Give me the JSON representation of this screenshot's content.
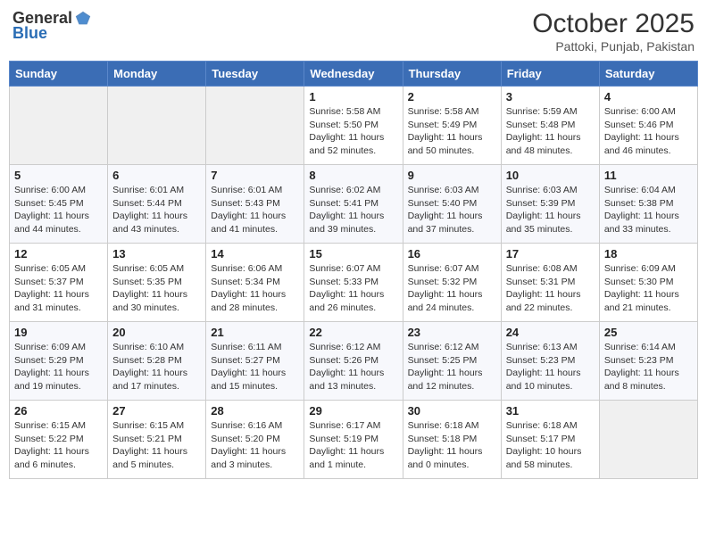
{
  "header": {
    "logo_general": "General",
    "logo_blue": "Blue",
    "month": "October 2025",
    "location": "Pattoki, Punjab, Pakistan"
  },
  "weekdays": [
    "Sunday",
    "Monday",
    "Tuesday",
    "Wednesday",
    "Thursday",
    "Friday",
    "Saturday"
  ],
  "weeks": [
    [
      {
        "day": "",
        "info": ""
      },
      {
        "day": "",
        "info": ""
      },
      {
        "day": "",
        "info": ""
      },
      {
        "day": "1",
        "info": "Sunrise: 5:58 AM\nSunset: 5:50 PM\nDaylight: 11 hours and 52 minutes."
      },
      {
        "day": "2",
        "info": "Sunrise: 5:58 AM\nSunset: 5:49 PM\nDaylight: 11 hours and 50 minutes."
      },
      {
        "day": "3",
        "info": "Sunrise: 5:59 AM\nSunset: 5:48 PM\nDaylight: 11 hours and 48 minutes."
      },
      {
        "day": "4",
        "info": "Sunrise: 6:00 AM\nSunset: 5:46 PM\nDaylight: 11 hours and 46 minutes."
      }
    ],
    [
      {
        "day": "5",
        "info": "Sunrise: 6:00 AM\nSunset: 5:45 PM\nDaylight: 11 hours and 44 minutes."
      },
      {
        "day": "6",
        "info": "Sunrise: 6:01 AM\nSunset: 5:44 PM\nDaylight: 11 hours and 43 minutes."
      },
      {
        "day": "7",
        "info": "Sunrise: 6:01 AM\nSunset: 5:43 PM\nDaylight: 11 hours and 41 minutes."
      },
      {
        "day": "8",
        "info": "Sunrise: 6:02 AM\nSunset: 5:41 PM\nDaylight: 11 hours and 39 minutes."
      },
      {
        "day": "9",
        "info": "Sunrise: 6:03 AM\nSunset: 5:40 PM\nDaylight: 11 hours and 37 minutes."
      },
      {
        "day": "10",
        "info": "Sunrise: 6:03 AM\nSunset: 5:39 PM\nDaylight: 11 hours and 35 minutes."
      },
      {
        "day": "11",
        "info": "Sunrise: 6:04 AM\nSunset: 5:38 PM\nDaylight: 11 hours and 33 minutes."
      }
    ],
    [
      {
        "day": "12",
        "info": "Sunrise: 6:05 AM\nSunset: 5:37 PM\nDaylight: 11 hours and 31 minutes."
      },
      {
        "day": "13",
        "info": "Sunrise: 6:05 AM\nSunset: 5:35 PM\nDaylight: 11 hours and 30 minutes."
      },
      {
        "day": "14",
        "info": "Sunrise: 6:06 AM\nSunset: 5:34 PM\nDaylight: 11 hours and 28 minutes."
      },
      {
        "day": "15",
        "info": "Sunrise: 6:07 AM\nSunset: 5:33 PM\nDaylight: 11 hours and 26 minutes."
      },
      {
        "day": "16",
        "info": "Sunrise: 6:07 AM\nSunset: 5:32 PM\nDaylight: 11 hours and 24 minutes."
      },
      {
        "day": "17",
        "info": "Sunrise: 6:08 AM\nSunset: 5:31 PM\nDaylight: 11 hours and 22 minutes."
      },
      {
        "day": "18",
        "info": "Sunrise: 6:09 AM\nSunset: 5:30 PM\nDaylight: 11 hours and 21 minutes."
      }
    ],
    [
      {
        "day": "19",
        "info": "Sunrise: 6:09 AM\nSunset: 5:29 PM\nDaylight: 11 hours and 19 minutes."
      },
      {
        "day": "20",
        "info": "Sunrise: 6:10 AM\nSunset: 5:28 PM\nDaylight: 11 hours and 17 minutes."
      },
      {
        "day": "21",
        "info": "Sunrise: 6:11 AM\nSunset: 5:27 PM\nDaylight: 11 hours and 15 minutes."
      },
      {
        "day": "22",
        "info": "Sunrise: 6:12 AM\nSunset: 5:26 PM\nDaylight: 11 hours and 13 minutes."
      },
      {
        "day": "23",
        "info": "Sunrise: 6:12 AM\nSunset: 5:25 PM\nDaylight: 11 hours and 12 minutes."
      },
      {
        "day": "24",
        "info": "Sunrise: 6:13 AM\nSunset: 5:23 PM\nDaylight: 11 hours and 10 minutes."
      },
      {
        "day": "25",
        "info": "Sunrise: 6:14 AM\nSunset: 5:23 PM\nDaylight: 11 hours and 8 minutes."
      }
    ],
    [
      {
        "day": "26",
        "info": "Sunrise: 6:15 AM\nSunset: 5:22 PM\nDaylight: 11 hours and 6 minutes."
      },
      {
        "day": "27",
        "info": "Sunrise: 6:15 AM\nSunset: 5:21 PM\nDaylight: 11 hours and 5 minutes."
      },
      {
        "day": "28",
        "info": "Sunrise: 6:16 AM\nSunset: 5:20 PM\nDaylight: 11 hours and 3 minutes."
      },
      {
        "day": "29",
        "info": "Sunrise: 6:17 AM\nSunset: 5:19 PM\nDaylight: 11 hours and 1 minute."
      },
      {
        "day": "30",
        "info": "Sunrise: 6:18 AM\nSunset: 5:18 PM\nDaylight: 11 hours and 0 minutes."
      },
      {
        "day": "31",
        "info": "Sunrise: 6:18 AM\nSunset: 5:17 PM\nDaylight: 10 hours and 58 minutes."
      },
      {
        "day": "",
        "info": ""
      }
    ]
  ]
}
